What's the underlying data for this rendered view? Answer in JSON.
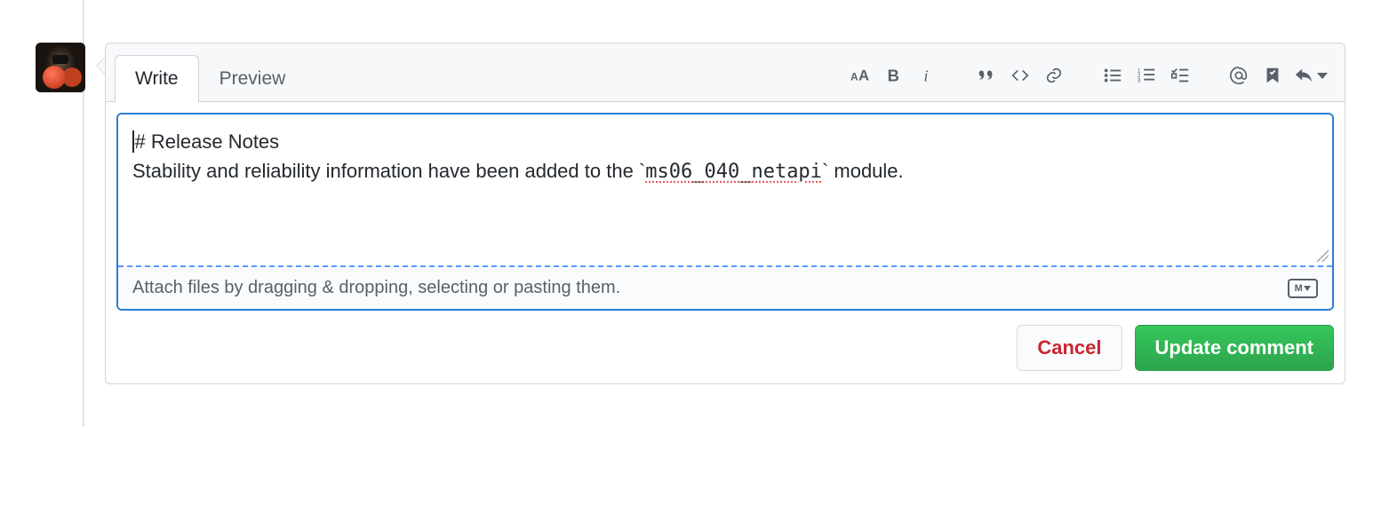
{
  "tabs": {
    "write": "Write",
    "preview": "Preview"
  },
  "toolbar": {
    "header": "header-icon",
    "bold": "bold-icon",
    "italic": "italic-icon",
    "quote": "quote-icon",
    "code": "code-icon",
    "link": "link-icon",
    "ul": "unordered-list-icon",
    "ol": "ordered-list-icon",
    "task": "task-list-icon",
    "mention": "mention-icon",
    "saved": "saved-reply-icon",
    "reply": "reply-icon"
  },
  "editor": {
    "line1_prefix": "#",
    "line1_rest": " Release Notes",
    "line2_before": "Stability and reliability information have been added to the `",
    "line2_code": "ms06_040_netapi",
    "line2_after": "` module."
  },
  "attach": {
    "text": "Attach files by dragging & dropping, selecting or pasting them."
  },
  "actions": {
    "cancel": "Cancel",
    "update": "Update comment"
  }
}
